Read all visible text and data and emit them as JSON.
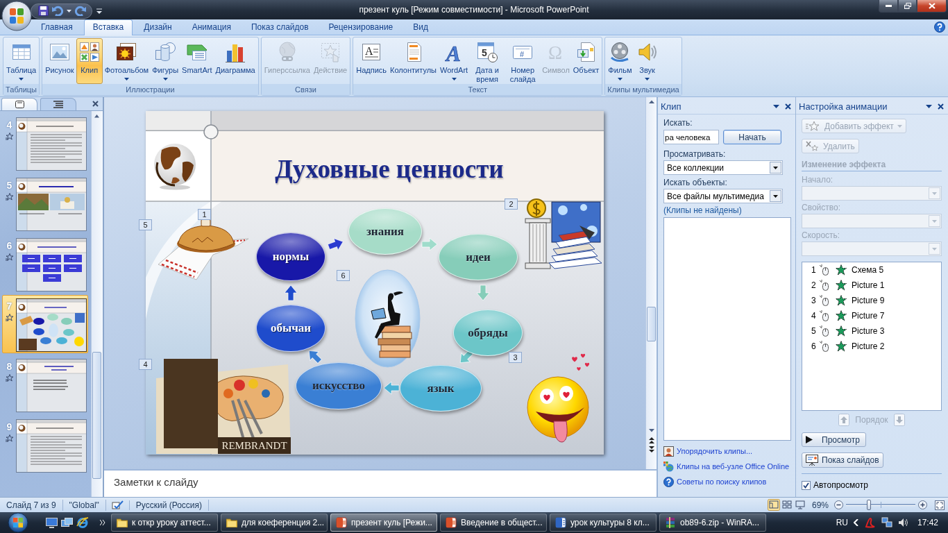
{
  "window": {
    "title": "презент куль [Режим совместимости] - Microsoft PowerPoint"
  },
  "ribbon": {
    "tabs": [
      {
        "label": "Главная",
        "selected": false
      },
      {
        "label": "Вставка",
        "selected": true
      },
      {
        "label": "Дизайн",
        "selected": false
      },
      {
        "label": "Анимация",
        "selected": false
      },
      {
        "label": "Показ слайдов",
        "selected": false
      },
      {
        "label": "Рецензирование",
        "selected": false
      },
      {
        "label": "Вид",
        "selected": false
      }
    ],
    "groups": [
      {
        "label": "Таблицы",
        "buttons": [
          {
            "label": "Таблица",
            "kind": "table",
            "menu": true,
            "pressed": false,
            "disabled": false
          }
        ]
      },
      {
        "label": "Иллюстрации",
        "buttons": [
          {
            "label": "Рисунок",
            "kind": "picture",
            "menu": false,
            "pressed": false,
            "disabled": false
          },
          {
            "label": "Клип",
            "kind": "clip",
            "menu": false,
            "pressed": true,
            "disabled": false
          },
          {
            "label": "Фотоальбом",
            "kind": "album",
            "menu": true,
            "pressed": false,
            "disabled": false
          },
          {
            "label": "Фигуры",
            "kind": "shapes",
            "menu": true,
            "pressed": false,
            "disabled": false
          },
          {
            "label": "SmartArt",
            "kind": "smartart",
            "menu": false,
            "pressed": false,
            "disabled": false
          },
          {
            "label": "Диаграмма",
            "kind": "chart",
            "menu": false,
            "pressed": false,
            "disabled": false
          }
        ]
      },
      {
        "label": "Связи",
        "buttons": [
          {
            "label": "Гиперссылка",
            "kind": "hyperlink",
            "menu": false,
            "pressed": false,
            "disabled": true
          },
          {
            "label": "Действие",
            "kind": "action",
            "menu": false,
            "pressed": false,
            "disabled": true
          }
        ]
      },
      {
        "label": "Текст",
        "buttons": [
          {
            "label": "Надпись",
            "kind": "textbox",
            "glyph": "A",
            "menu": false,
            "pressed": false,
            "disabled": false
          },
          {
            "label": "Колонтитулы",
            "kind": "header",
            "menu": false,
            "pressed": false,
            "disabled": false
          },
          {
            "label": "WordArt",
            "kind": "wordart",
            "glyph": "A",
            "menu": true,
            "pressed": false,
            "disabled": false
          },
          {
            "label": "Дата и время",
            "kind": "date",
            "glyph": "5",
            "menu": false,
            "pressed": false,
            "disabled": false
          },
          {
            "label": "Номер слайда",
            "kind": "number",
            "glyph": "#",
            "menu": false,
            "pressed": false,
            "disabled": false
          },
          {
            "label": "Символ",
            "kind": "symbol",
            "glyph": "Ω",
            "menu": false,
            "pressed": false,
            "disabled": true
          },
          {
            "label": "Объект",
            "kind": "object",
            "menu": false,
            "pressed": false,
            "disabled": false
          }
        ]
      },
      {
        "label": "Клипы мультимедиа",
        "buttons": [
          {
            "label": "Фильм",
            "kind": "movie",
            "menu": true,
            "pressed": false,
            "disabled": false
          },
          {
            "label": "Звук",
            "kind": "sound",
            "menu": true,
            "pressed": false,
            "disabled": false
          }
        ]
      }
    ]
  },
  "slides_pane": {
    "tabs": [
      {
        "kind": "slides",
        "selected": true
      },
      {
        "kind": "outline",
        "selected": false
      }
    ],
    "thumbnails": [
      {
        "number": "4",
        "kind": "text",
        "selected": false
      },
      {
        "number": "5",
        "kind": "images",
        "selected": false
      },
      {
        "number": "6",
        "kind": "boxes",
        "selected": false
      },
      {
        "number": "7",
        "kind": "diagram",
        "selected": true
      },
      {
        "number": "8",
        "kind": "bullets",
        "selected": false
      },
      {
        "number": "9",
        "kind": "text",
        "selected": false
      }
    ]
  },
  "slide": {
    "title": "Духовные ценности",
    "cycle": [
      {
        "label": "нормы",
        "color": "#1818a8"
      },
      {
        "label": "знания",
        "color": "#a6dcc8"
      },
      {
        "label": "идеи",
        "color": "#86cdb9"
      },
      {
        "label": "обряды",
        "color": "#6cc6c8"
      },
      {
        "label": "язык",
        "color": "#4cb2d6"
      },
      {
        "label": "искусство",
        "color": "#3a7fd4"
      },
      {
        "label": "обычаи",
        "color": "#1f4ccc"
      }
    ],
    "tags": [
      "1",
      "2",
      "3",
      "4",
      "5",
      "6"
    ],
    "caption": "REMBRANDT"
  },
  "notes": {
    "placeholder": "Заметки к слайду"
  },
  "clip_pane": {
    "title": "Клип",
    "search_label": "Искать:",
    "search_value": "ра человека",
    "search_button": "Начать",
    "browse_label": "Просматривать:",
    "browse_value": "Все коллекции",
    "types_label": "Искать объекты:",
    "types_value": "Все файлы мультимедиа",
    "status": "(Клипы не найдены)",
    "links": [
      {
        "label": "Упорядочить клипы...",
        "kind": "organize"
      },
      {
        "label": "Клипы на веб-узле Office Online",
        "kind": "online"
      },
      {
        "label": "Советы по поиску клипов",
        "kind": "help"
      }
    ]
  },
  "animation_pane": {
    "title": "Настройка анимации",
    "add_button": {
      "label": "Добавить эффект",
      "disabled": true
    },
    "remove_button": {
      "label": "Удалить",
      "disabled": true
    },
    "section": {
      "label": "Изменение эффекта",
      "disabled": true
    },
    "fields": [
      {
        "label": "Начало:",
        "disabled": true
      },
      {
        "label": "Свойство:",
        "disabled": true
      },
      {
        "label": "Скорость:",
        "disabled": true
      }
    ],
    "effects": [
      {
        "order": "1",
        "name": "Схема 5",
        "selected": false
      },
      {
        "order": "2",
        "name": "Picture 1",
        "selected": false
      },
      {
        "order": "3",
        "name": "Picture 9",
        "selected": false
      },
      {
        "order": "4",
        "name": "Picture 7",
        "selected": false
      },
      {
        "order": "5",
        "name": "Picture 3",
        "selected": false
      },
      {
        "order": "6",
        "name": "Picture 2",
        "selected": false
      }
    ],
    "order": {
      "label": "Порядок",
      "disabled": true
    },
    "preview_button": "Просмотр",
    "slideshow_button": "Показ слайдов",
    "autopreview": {
      "label": "Автопросмотр",
      "checked": true
    }
  },
  "status_bar": {
    "slide": "Слайд 7 из 9",
    "theme": "\"Global\"",
    "language": "Русский (Россия)",
    "views": [
      {
        "kind": "normal",
        "selected": true
      },
      {
        "kind": "sorter",
        "selected": false
      },
      {
        "kind": "show",
        "selected": false
      }
    ],
    "zoom": "69%",
    "zoom_slider": {
      "level": 0.33
    }
  },
  "taskbar": {
    "tasks": [
      {
        "label": "к откр уроку аттест...",
        "kind": "folder",
        "selected": false
      },
      {
        "label": "для коеференция 2...",
        "kind": "folder",
        "selected": false
      },
      {
        "label": "презент куль [Режи...",
        "kind": "presentation",
        "selected": true
      },
      {
        "label": "Введение в общест...",
        "kind": "presentation",
        "selected": false
      },
      {
        "label": "урок культуры 8 кл...",
        "kind": "document",
        "selected": false
      },
      {
        "label": "ob89-6.zip - WinRA...",
        "kind": "archive",
        "selected": false
      }
    ],
    "language": "RU",
    "clock": "17:42"
  }
}
